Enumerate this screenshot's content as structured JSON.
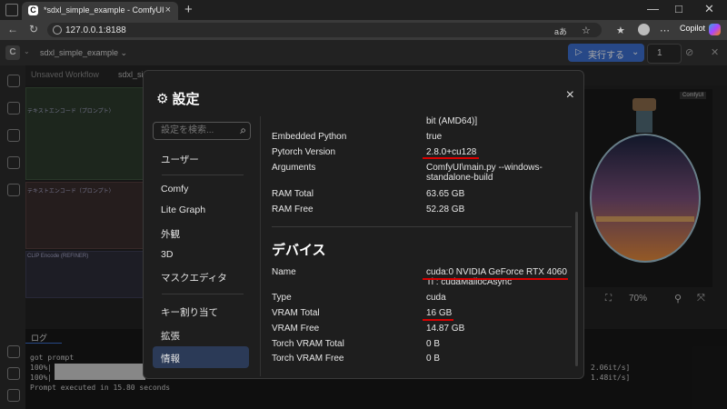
{
  "browser": {
    "tab_title": "*sdxl_simple_example - ComfyUI",
    "tab_close": "×",
    "new_tab": "+",
    "url": "127.0.0.1:8188",
    "read_aloud": "aあ",
    "copilot_label": "Copilot",
    "window": {
      "minimize": "—",
      "maximize": "□",
      "close": "✕"
    }
  },
  "app": {
    "workflow_name": "sdxl_simple_example ⌄",
    "run_label": "実行する",
    "run_count": "1",
    "tabs": [
      "Unsaved Workflow",
      "sdxl_si"
    ],
    "image_tag": "ComfyUI",
    "zoom": "70%",
    "log_tab": "ログ",
    "log_lines": [
      "got prompt",
      "100%|",
      "100%|",
      "Prompt executed in 15.80 seconds"
    ],
    "log_speeds": [
      "2.06it/s]",
      "1.48it/s]"
    ],
    "node_labels": [
      "テキストエンコード（プロンプト）",
      "テキストエンコード（プロンプト）",
      "CLIP Encode (REFINER)"
    ]
  },
  "dialog": {
    "title": "設定",
    "close": "×",
    "search_placeholder": "設定を検索...",
    "nav": [
      "ユーザー",
      "Comfy",
      "Lite Graph",
      "外観",
      "3D",
      "マスクエディタ",
      "キー割り当て",
      "拡張",
      "情報"
    ],
    "active_nav": "情報",
    "system_rows": [
      {
        "label": "",
        "value": "bit (AMD64)]"
      },
      {
        "label": "Embedded Python",
        "value": "true"
      },
      {
        "label": "Pytorch Version",
        "value": "2.8.0+cu128"
      },
      {
        "label": "Arguments",
        "value": "ComfyUI\\main.py --windows-standalone-build"
      },
      {
        "label": "RAM Total",
        "value": "63.65 GB"
      },
      {
        "label": "RAM Free",
        "value": "52.28 GB"
      }
    ],
    "device_header": "デバイス",
    "device_rows": [
      {
        "label": "Name",
        "value": "cuda:0 NVIDIA GeForce RTX 4060 Ti : cudaMallocAsync"
      },
      {
        "label": "Type",
        "value": "cuda"
      },
      {
        "label": "VRAM Total",
        "value": "16 GB"
      },
      {
        "label": "VRAM Free",
        "value": "14.87 GB"
      },
      {
        "label": "Torch VRAM Total",
        "value": "0 B"
      },
      {
        "label": "Torch VRAM Free",
        "value": "0 B"
      }
    ],
    "annotation_color": "#d80000"
  }
}
